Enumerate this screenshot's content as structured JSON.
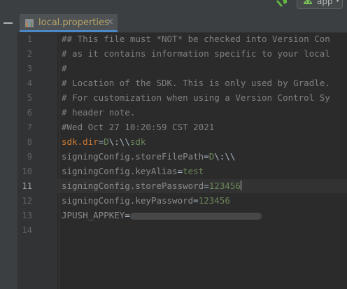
{
  "toolbar": {
    "run_config": "app"
  },
  "tabs": [
    {
      "label": "local.properties"
    }
  ],
  "editor": {
    "line_numbers": [
      "1",
      "2",
      "3",
      "4",
      "5",
      "6",
      "7",
      "8",
      "9",
      "10",
      "11",
      "12",
      "13",
      "14"
    ],
    "active_line": "11",
    "lines": {
      "l1": "## This file must *NOT* be checked into Version Con",
      "l2": "# as it contains information specific to your local",
      "l3": "#",
      "l4": "# Location of the SDK. This is only used by Gradle.",
      "l5": "# For customization when using a Version Control Sy",
      "l6": "# header note.",
      "l7": "#Wed Oct 27 10:20:59 CST 2021",
      "l8_key": "sdk.dir",
      "l8_eq": "=",
      "l8_val_a": "D",
      "l8_esc_a": "\\:\\\\",
      "l8_val_b": "sdk",
      "l9_key": "signingConfig.storeFilePath",
      "l9_eq": "=",
      "l9_val_a": "D",
      "l9_esc_a": "\\:\\\\",
      "l10_key": "signingConfig.keyAlias",
      "l10_eq": "=",
      "l10_val": "test",
      "l11_key": "signingConfig.storePassword",
      "l11_eq": "=",
      "l11_val": "123456",
      "l12_key": "signingConfig.keyPassword",
      "l12_eq": "=",
      "l12_val": "123456",
      "l13_key": "JPUSH_APPKEY",
      "l13_eq": "="
    }
  }
}
